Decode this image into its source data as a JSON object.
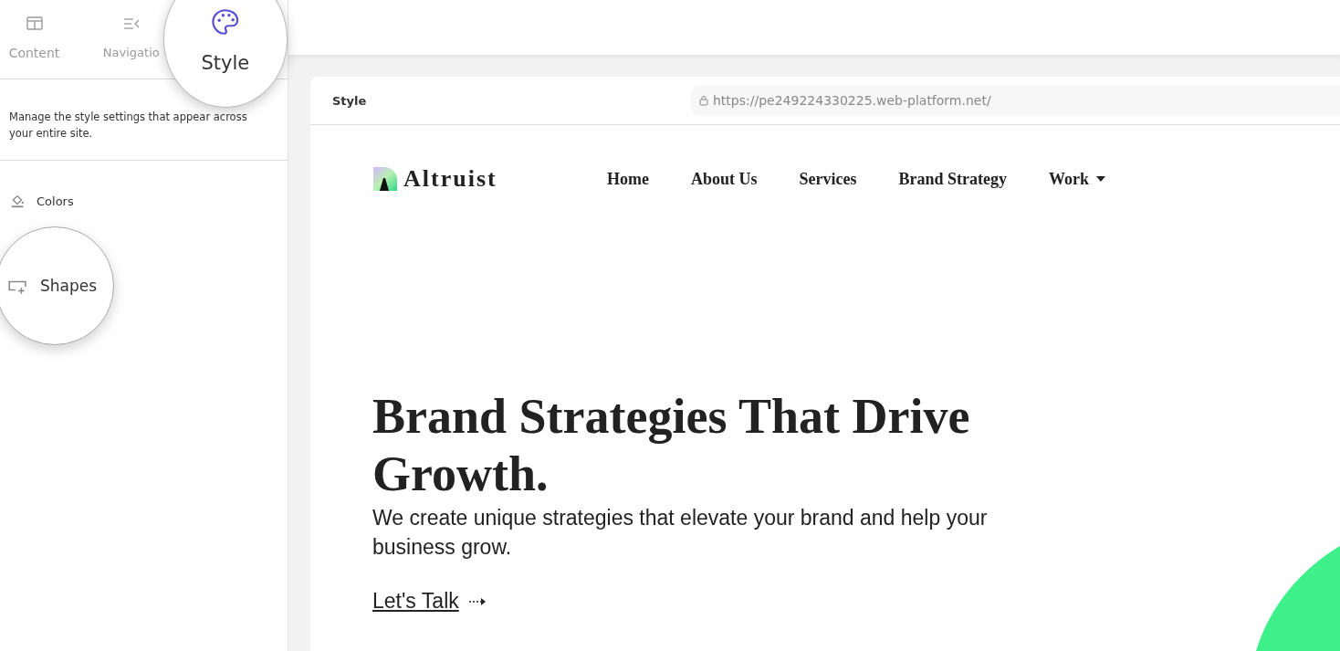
{
  "editor_tabs": [
    {
      "label": "Content",
      "selected": false
    },
    {
      "label": "Navigatio",
      "selected": false
    },
    {
      "label": "Style",
      "selected": true
    }
  ],
  "panel": {
    "description": "Manage the style settings that appear across your entire site.",
    "items": [
      {
        "label": "Colors",
        "kind": "colors",
        "highlighted": false
      },
      {
        "label": "Shapes",
        "kind": "shapes",
        "highlighted": true
      }
    ]
  },
  "preview": {
    "title": "Style",
    "url": "https://pe249224330225.web-platform.net/"
  },
  "site": {
    "logo": "Altruist",
    "nav": [
      {
        "label": "Home",
        "dropdown": false
      },
      {
        "label": "About Us",
        "dropdown": false
      },
      {
        "label": "Services",
        "dropdown": false
      },
      {
        "label": "Brand Strategy",
        "dropdown": false
      },
      {
        "label": "Work",
        "dropdown": true
      }
    ],
    "heading": "Brand Strategies That Drive Growth.",
    "subheading": "We create unique strategies that elevate your brand and help your business grow.",
    "cta": "Let's Talk"
  }
}
